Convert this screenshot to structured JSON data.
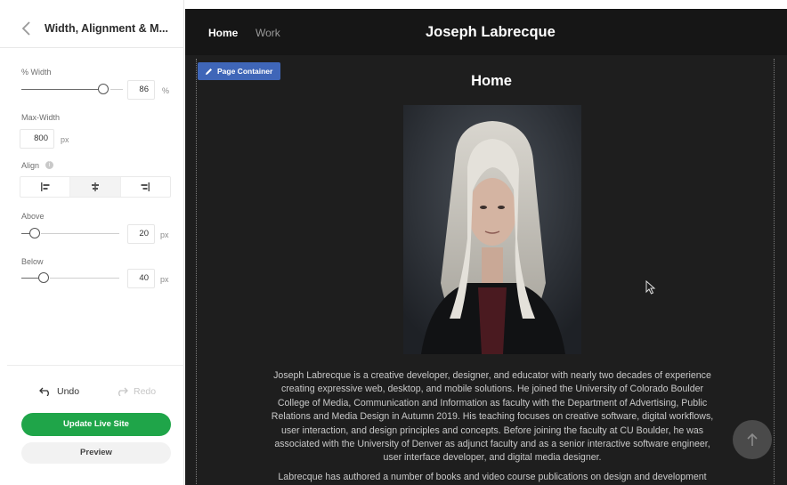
{
  "panel": {
    "title": "Width, Alignment & M...",
    "width": {
      "label": "% Width",
      "value": "86",
      "unit": "%"
    },
    "max_width": {
      "label": "Max-Width",
      "value": "800",
      "unit": "px"
    },
    "align": {
      "label": "Align"
    },
    "above": {
      "label": "Above",
      "value": "20",
      "unit": "px"
    },
    "below": {
      "label": "Below",
      "value": "40",
      "unit": "px"
    },
    "undo_label": "Undo",
    "redo_label": "Redo",
    "update_label": "Update Live Site",
    "preview_label": "Preview"
  },
  "site": {
    "nav": {
      "home": "Home",
      "work": "Work"
    },
    "title": "Joseph Labrecque",
    "container_tag": "Page Container",
    "heading": "Home",
    "bio_lines": [
      "Joseph Labrecque is a creative developer, designer, and educator with nearly two decades of experience",
      "creating expressive web, desktop, and mobile solutions. He joined the University of Colorado Boulder",
      "College of Media, Communication and Information as faculty with the Department of Advertising, Public",
      "Relations and Media Design in Autumn 2019. His teaching focuses on creative software, digital workflows,",
      "user interaction, and design principles and concepts. Before joining the faculty at CU Boulder, he was",
      "associated with the University of Denver as adjunct faculty and as a senior interactive software engineer,",
      "user interface developer, and digital media designer."
    ],
    "bio_second": "Labrecque has authored a number of books and video course publications on design and development"
  },
  "colors": {
    "accent_green": "#1fa549",
    "tag_blue": "#3f66b8",
    "preview_bg": "#1e1e1e"
  },
  "icons": [
    "back-icon",
    "info-icon",
    "align-left-icon",
    "align-center-icon",
    "align-right-icon",
    "undo-icon",
    "redo-icon",
    "pencil-icon",
    "arrow-up-icon",
    "cursor-icon"
  ]
}
